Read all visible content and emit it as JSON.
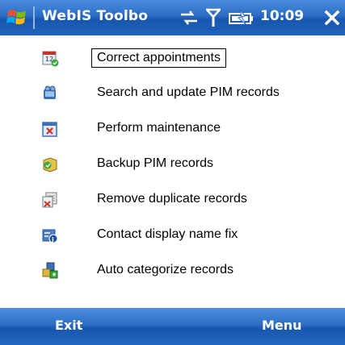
{
  "titlebar": {
    "title": "WebIS Toolbo",
    "time": "10:09",
    "icons": [
      "windows-logo",
      "data-connection-icon",
      "signal-icon",
      "battery-icon",
      "close-icon"
    ]
  },
  "menu": {
    "items": [
      {
        "label": "Correct appointments",
        "icon": "calendar-icon",
        "selected": true
      },
      {
        "label": "Search and update PIM records",
        "icon": "search-records-icon",
        "selected": false
      },
      {
        "label": "Perform maintenance",
        "icon": "maintenance-icon",
        "selected": false
      },
      {
        "label": "Backup PIM records",
        "icon": "backup-icon",
        "selected": false
      },
      {
        "label": "Remove duplicate records",
        "icon": "remove-duplicates-icon",
        "selected": false
      },
      {
        "label": "Contact display name fix",
        "icon": "contact-fix-icon",
        "selected": false
      },
      {
        "label": "Auto categorize records",
        "icon": "categorize-icon",
        "selected": false
      }
    ]
  },
  "softkeys": {
    "left": "Exit",
    "right": "Menu"
  },
  "colors": {
    "titlebar": "#2a6cc4",
    "softbar": "#2c6fc6",
    "background": "#ffffff"
  }
}
